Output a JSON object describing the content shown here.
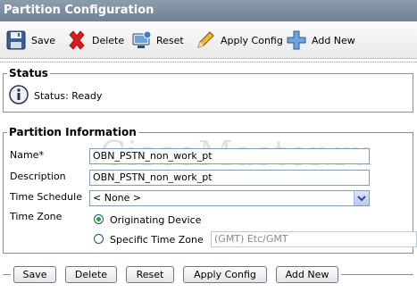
{
  "window": {
    "title": "Partition Configuration"
  },
  "toolbar": {
    "save_label": "Save",
    "delete_label": "Delete",
    "reset_label": "Reset",
    "apply_config_label": "Apply Config",
    "add_new_label": "Add New"
  },
  "status": {
    "legend": "Status",
    "text": "Status: Ready"
  },
  "partition_info": {
    "legend": "Partition Information",
    "name_label": "Name*",
    "name_value": "OBN_PSTN_non_work_pt",
    "description_label": "Description",
    "description_value": "OBN_PSTN_non_work_pt",
    "time_schedule_label": "Time Schedule",
    "time_schedule_value": "< None >",
    "time_zone_label": "Time Zone",
    "tz_option_originating": "Originating Device",
    "tz_option_specific": "Specific Time Zone",
    "tz_specific_value": "(GMT) Etc/GMT",
    "tz_selected": "originating"
  },
  "bottom_buttons": {
    "save": "Save",
    "delete": "Delete",
    "reset": "Reset",
    "apply_config": "Apply Config",
    "add_new": "Add New"
  },
  "watermark": "CiscoMaster.ru",
  "colors": {
    "title_bar": "#7a8ca0",
    "radio_selected": "#2aa42a"
  }
}
